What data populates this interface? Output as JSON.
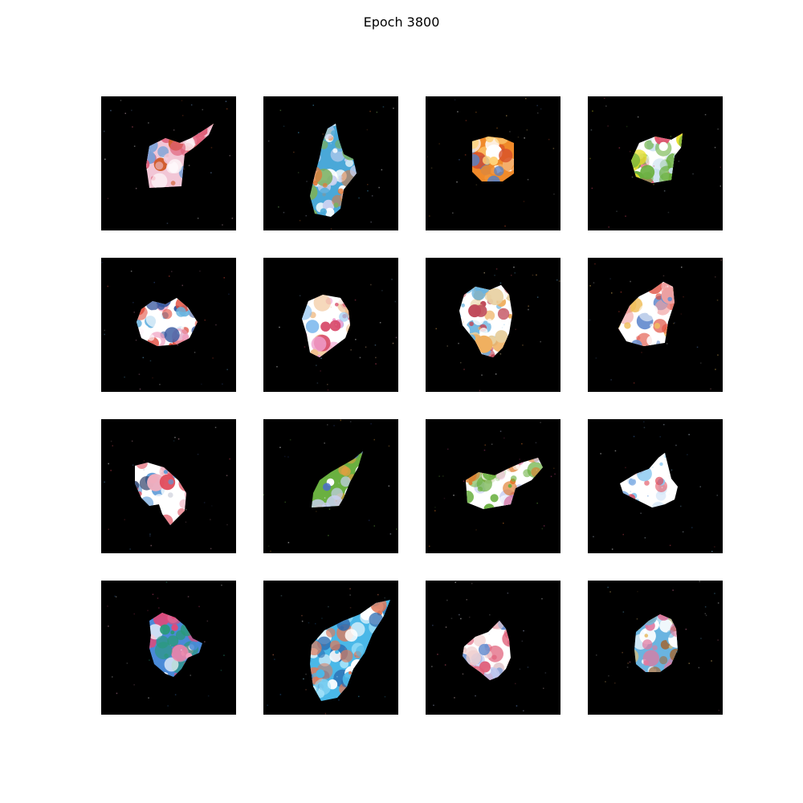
{
  "title": "Epoch 3800",
  "grid": {
    "rows": 4,
    "cols": 4,
    "tiles": [
      {
        "palette": [
          "#f2c6d6",
          "#ffffff",
          "#e0607a",
          "#d05a28",
          "#7aa2d8"
        ]
      },
      {
        "palette": [
          "#4aa8d8",
          "#ffffff",
          "#e07a3a",
          "#7ab060",
          "#c8d0f0"
        ]
      },
      {
        "palette": [
          "#f08a2a",
          "#d8502a",
          "#ffd27a",
          "#5a80c0",
          "#ffffff"
        ]
      },
      {
        "palette": [
          "#ffffff",
          "#c8e0f0",
          "#e8e02a",
          "#6ab040",
          "#e04a6a"
        ]
      },
      {
        "palette": [
          "#ffffff",
          "#e04a3a",
          "#6ab4e0",
          "#f0a0c0",
          "#3a5aa0"
        ]
      },
      {
        "palette": [
          "#ffffff",
          "#f0a0d0",
          "#d84a6a",
          "#8ac0f0",
          "#f0c090"
        ]
      },
      {
        "palette": [
          "#ffffff",
          "#f0b060",
          "#6ab4e0",
          "#c04a5a",
          "#e8d0a0"
        ]
      },
      {
        "palette": [
          "#ffffff",
          "#e04a3a",
          "#f0a0a0",
          "#6a90d0",
          "#f0c060"
        ]
      },
      {
        "palette": [
          "#ffffff",
          "#e04a5a",
          "#5a9ad8",
          "#f0b0c0",
          "#30406a"
        ]
      },
      {
        "palette": [
          "#6ab040",
          "#e0a040",
          "#c8d0f0",
          "#ffffff",
          "#4a6ad0"
        ]
      },
      {
        "palette": [
          "#ffffff",
          "#c0c8f0",
          "#e07a2a",
          "#6ab040",
          "#d04a8a"
        ]
      },
      {
        "palette": [
          "#ffffff",
          "#8ac8f0",
          "#4a8ad8",
          "#e04a5a",
          "#d8e8f8"
        ]
      },
      {
        "palette": [
          "#4a8ad8",
          "#ffffff",
          "#e04a7a",
          "#2a9a7a",
          "#f0a0c0"
        ]
      },
      {
        "palette": [
          "#4ab8e8",
          "#ffffff",
          "#2a6ab0",
          "#e07a5a",
          "#a0e0f8"
        ]
      },
      {
        "palette": [
          "#ffffff",
          "#c0c8f0",
          "#e0607a",
          "#6a90d0",
          "#f0d0d0"
        ]
      },
      {
        "palette": [
          "#6ab4e0",
          "#e8c070",
          "#e07aa0",
          "#ffffff",
          "#a06a3a"
        ]
      }
    ]
  }
}
